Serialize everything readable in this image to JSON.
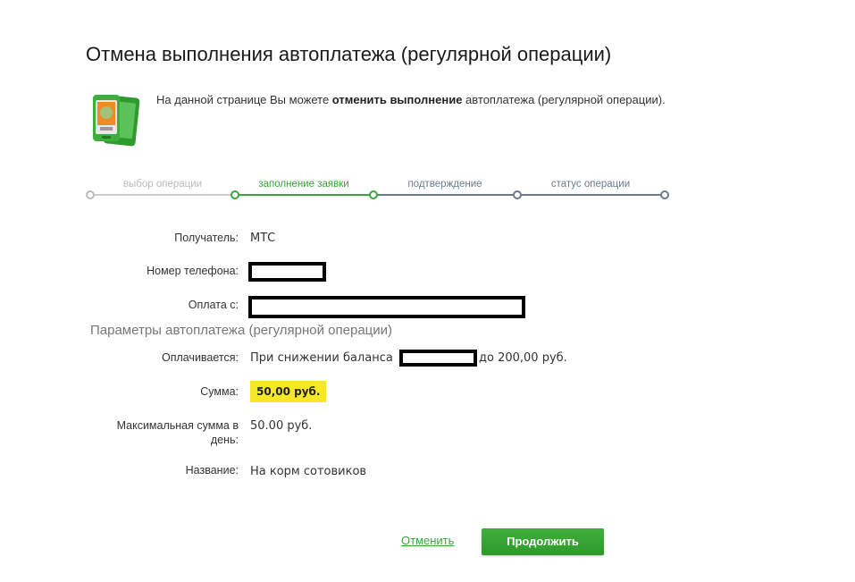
{
  "page": {
    "title": "Отмена выполнения автоплатежа (регулярной операции)"
  },
  "intro": {
    "text_before": "На данной странице Вы можете ",
    "text_bold": "отменить выполнение",
    "text_after": " автоплатежа (регулярной операции).",
    "icon": "mobile-phone-card-icon"
  },
  "steps": [
    {
      "label": "выбор операции",
      "state": "done"
    },
    {
      "label": "заполнение заявки",
      "state": "active"
    },
    {
      "label": "подтверждение",
      "state": "pending"
    },
    {
      "label": "статус операции",
      "state": "pending"
    }
  ],
  "form": {
    "recipient_label": "Получатель:",
    "recipient_value": "МТС",
    "phone_label": "Номер телефона:",
    "payfrom_label": "Оплата с:"
  },
  "params": {
    "section_title": "Параметры автоплатежа (регулярной операции)",
    "paid_label": "Оплачивается:",
    "paid_prefix": "При снижении баланса",
    "paid_suffix": "до  200,00  руб.",
    "sum_label": "Сумма:",
    "sum_value": "50,00  руб.",
    "max_label_line1": "Максимальная сумма в",
    "max_label_line2": "день:",
    "max_value": "50.00 руб.",
    "name_label": "Название:",
    "name_value": "На корм сотовиков"
  },
  "actions": {
    "cancel_label": "Отменить",
    "continue_label": "Продолжить"
  },
  "colors": {
    "accent": "#3aa53a",
    "step_done": "#cccccc",
    "step_active": "#3aa53a",
    "step_pending": "#6b7a8a",
    "highlight": "#f7e827"
  }
}
